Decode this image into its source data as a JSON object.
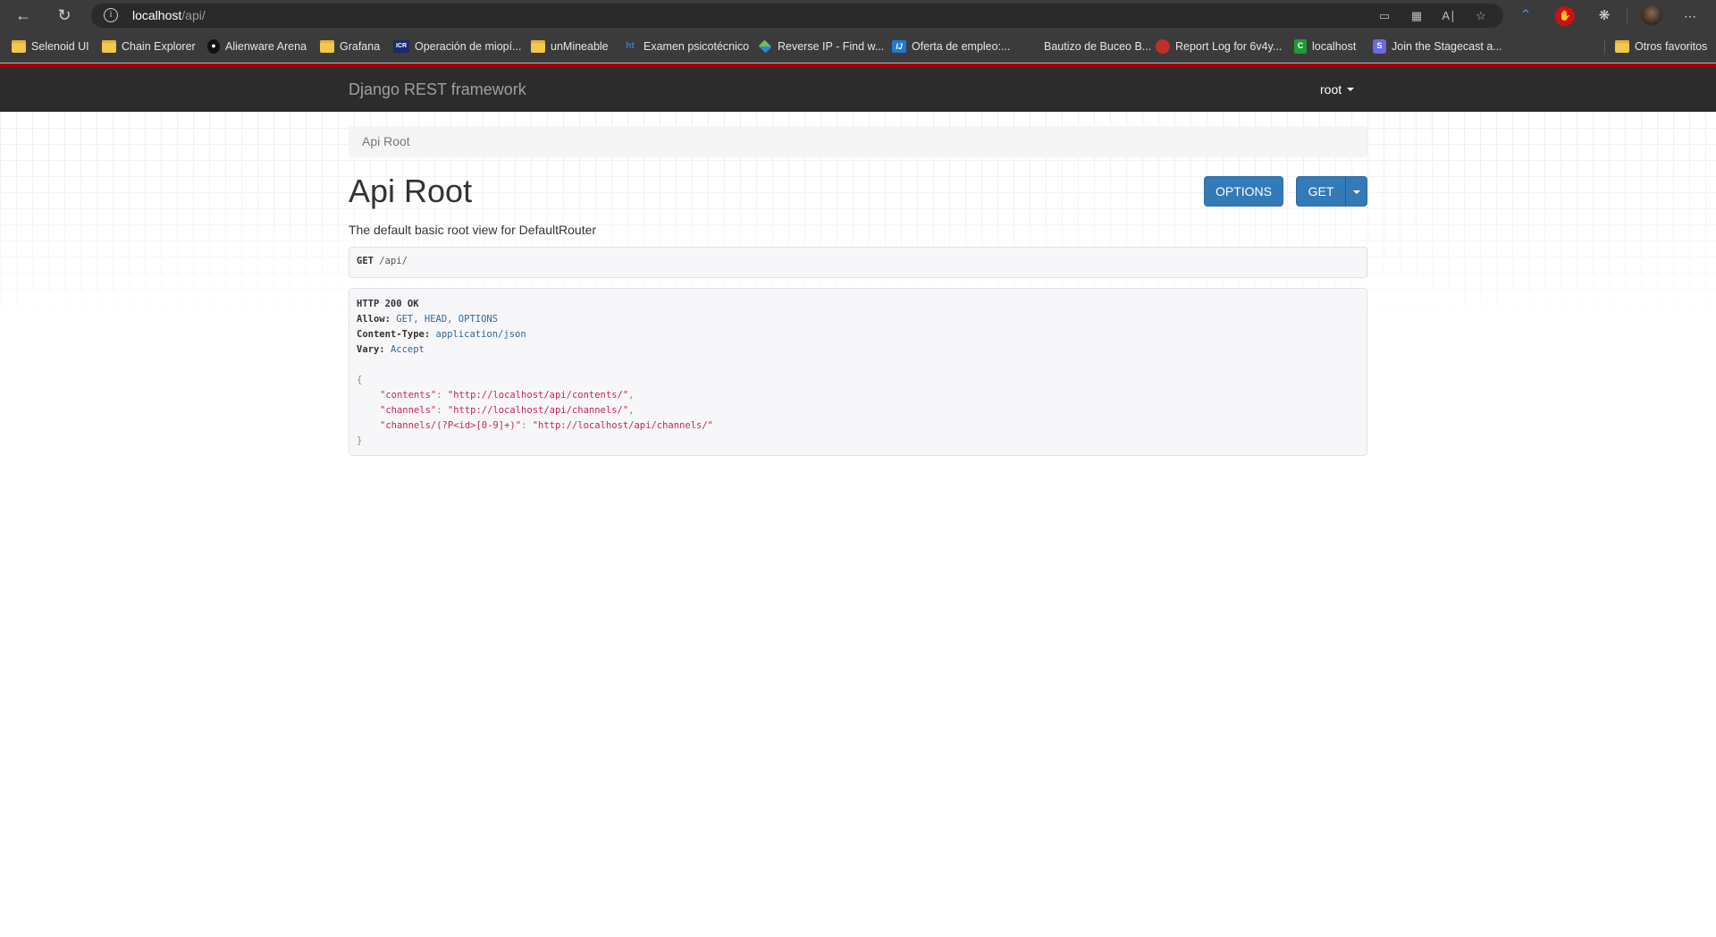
{
  "browser": {
    "url_host": "localhost",
    "url_path": "/api/",
    "bookmarks": [
      {
        "label": "Selenoid UI",
        "icon": "folder-icon"
      },
      {
        "label": "Chain Explorer",
        "icon": "folder-icon"
      },
      {
        "label": "Alienware Arena",
        "icon": "alien-icon"
      },
      {
        "label": "Grafana",
        "icon": "folder-icon"
      },
      {
        "label": "Operación de miopí...",
        "icon": "icr-icon"
      },
      {
        "label": "unMineable",
        "icon": "folder-icon"
      },
      {
        "label": "Examen psicotécnico",
        "icon": "ht-icon"
      },
      {
        "label": "Reverse IP - Find w...",
        "icon": "diamond-icon"
      },
      {
        "label": "Oferta de empleo:...",
        "icon": "ij-icon"
      },
      {
        "label": "Bautizo de Buceo B...",
        "icon": "blank-icon"
      },
      {
        "label": "Report Log for 6v4y...",
        "icon": "steam-icon"
      },
      {
        "label": "localhost",
        "icon": "c-icon"
      },
      {
        "label": "Join the Stagecast a...",
        "icon": "s-icon"
      }
    ],
    "other_favorites": "Otros favoritos"
  },
  "navbar": {
    "brand": "Django REST framework",
    "user": "root"
  },
  "breadcrumb": {
    "items": [
      "Api Root"
    ]
  },
  "page": {
    "title": "Api Root",
    "description": "The default basic root view for DefaultRouter",
    "buttons": {
      "options": "OPTIONS",
      "get": "GET"
    }
  },
  "request": {
    "method": "GET",
    "path": "/api/"
  },
  "response": {
    "status": "HTTP 200 OK",
    "headers": [
      {
        "key": "Allow:",
        "value": "GET, HEAD, OPTIONS"
      },
      {
        "key": "Content-Type:",
        "value": "application/json"
      },
      {
        "key": "Vary:",
        "value": "Accept"
      }
    ],
    "open_brace": "{",
    "close_brace": "}",
    "body": [
      {
        "key": "\"contents\"",
        "value": "\"http://localhost/api/contents/\"",
        "trail": ","
      },
      {
        "key": "\"channels\"",
        "value": "\"http://localhost/api/channels/\"",
        "trail": ","
      },
      {
        "key": "\"channels/(?P<id>[0-9]+)\"",
        "value": "\"http://localhost/api/channels/\"",
        "trail": ""
      }
    ]
  },
  "colors": {
    "accent_red": "#a30000",
    "button_blue": "#337ab7",
    "navbar_bg": "#2c2c2c",
    "json_string": "#c7254e",
    "header_value": "#336699"
  }
}
